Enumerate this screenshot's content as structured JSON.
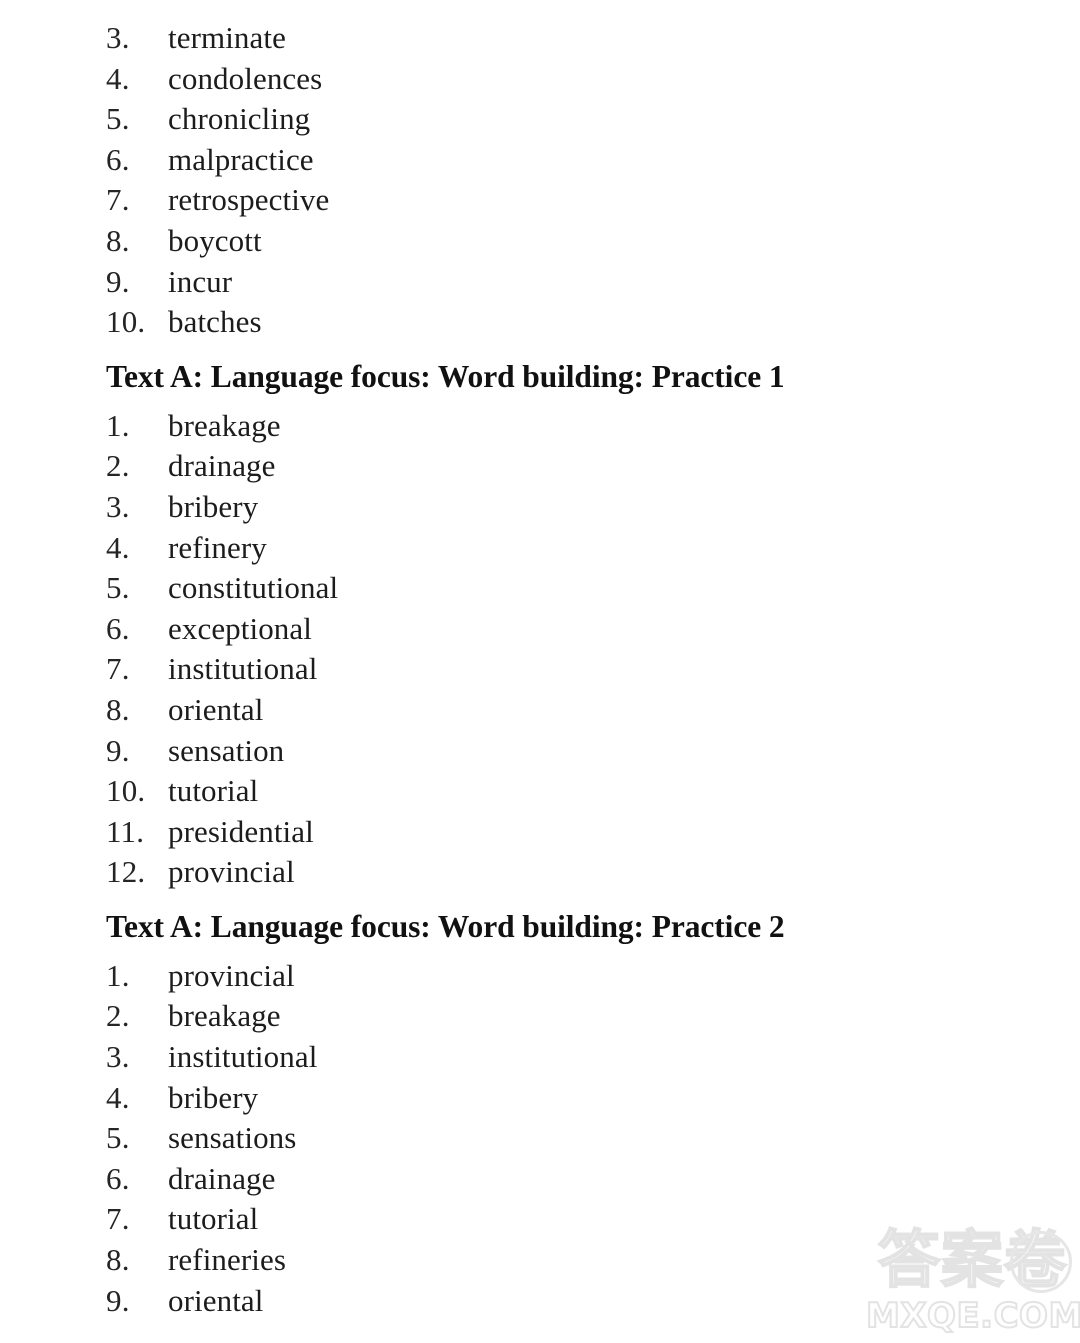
{
  "document": {
    "background_color": "#ffffff",
    "text_color": "#1a1a1a"
  },
  "sections": [
    {
      "id": "continued-list",
      "heading": null,
      "items": [
        {
          "number": "3.",
          "word": "terminate"
        },
        {
          "number": "4.",
          "word": "condolences"
        },
        {
          "number": "5.",
          "word": "chronicling"
        },
        {
          "number": "6.",
          "word": "malpractice"
        },
        {
          "number": "7.",
          "word": "retrospective"
        },
        {
          "number": "8.",
          "word": "boycott"
        },
        {
          "number": "9.",
          "word": "incur"
        },
        {
          "number": "10.",
          "word": "batches"
        }
      ]
    },
    {
      "id": "practice-1",
      "heading": "Text A: Language focus: Word building: Practice 1",
      "items": [
        {
          "number": "1.",
          "word": "breakage"
        },
        {
          "number": "2.",
          "word": "drainage"
        },
        {
          "number": "3.",
          "word": "bribery"
        },
        {
          "number": "4.",
          "word": "refinery"
        },
        {
          "number": "5.",
          "word": "constitutional"
        },
        {
          "number": "6.",
          "word": "exceptional"
        },
        {
          "number": "7.",
          "word": "institutional"
        },
        {
          "number": "8.",
          "word": "oriental"
        },
        {
          "number": "9.",
          "word": "sensation"
        },
        {
          "number": "10.",
          "word": "tutorial"
        },
        {
          "number": "11.",
          "word": "presidential"
        },
        {
          "number": "12.",
          "word": "provincial"
        }
      ]
    },
    {
      "id": "practice-2",
      "heading": "Text A: Language focus: Word building: Practice 2",
      "items": [
        {
          "number": "1.",
          "word": "provincial"
        },
        {
          "number": "2.",
          "word": "breakage"
        },
        {
          "number": "3.",
          "word": "institutional"
        },
        {
          "number": "4.",
          "word": "bribery"
        },
        {
          "number": "5.",
          "word": "sensations"
        },
        {
          "number": "6.",
          "word": "drainage"
        },
        {
          "number": "7.",
          "word": "tutorial"
        },
        {
          "number": "8.",
          "word": "refineries"
        },
        {
          "number": "9.",
          "word": "oriental"
        }
      ]
    }
  ],
  "watermark": {
    "cjk_text": "答案卷",
    "domain_text": "MXQE.COM",
    "color": "#e3e3e3"
  }
}
